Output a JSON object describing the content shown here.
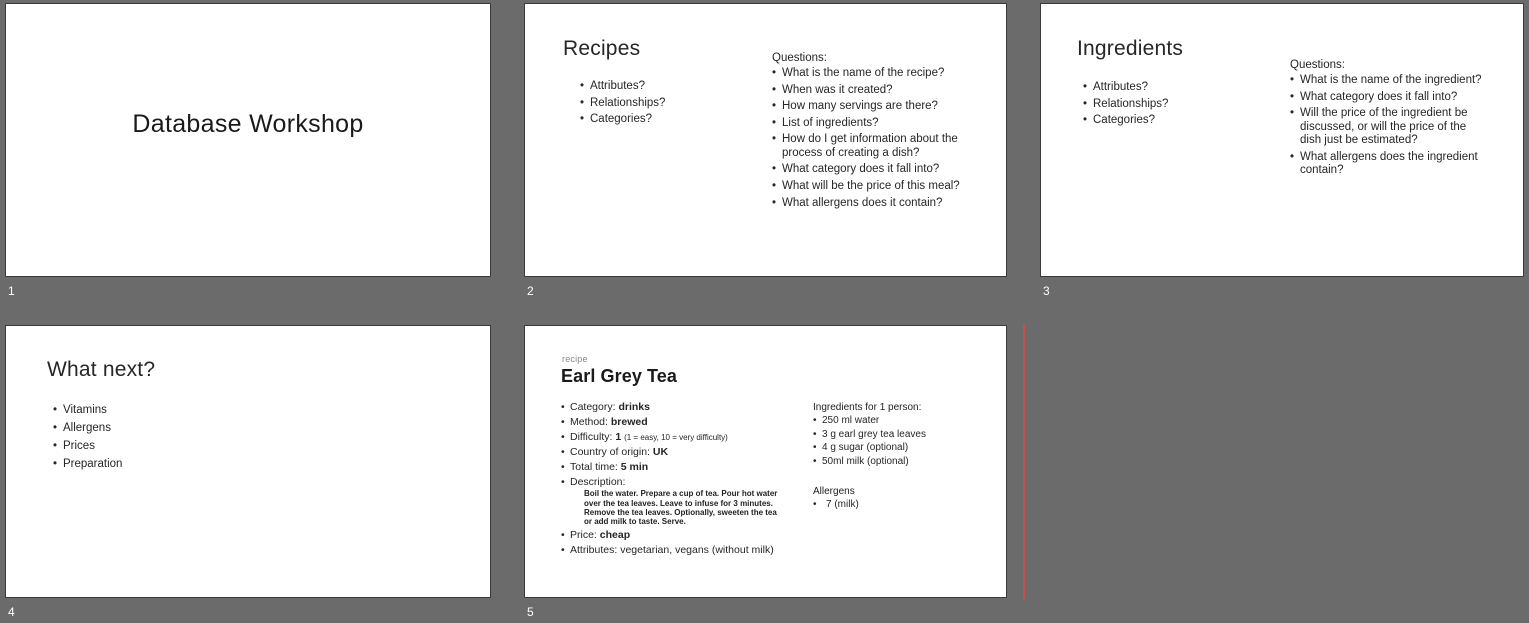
{
  "app": {
    "view": "slide-sorter",
    "background_color": "#6b6b6b",
    "slide_border_color": "#3a3a3a",
    "insertion_marker_color": "#c0504d"
  },
  "slides": [
    {
      "number": "1",
      "title": "Database Workshop"
    },
    {
      "number": "2",
      "title": "Recipes",
      "left_bullets": [
        "Attributes?",
        "Relationships?",
        "Categories?"
      ],
      "right_heading": "Questions:",
      "right_bullets": [
        "What is the name of the recipe?",
        "When was it created?",
        "How many servings are there?",
        "List of ingredients?",
        "How do I get information about the process of creating a dish?",
        "What category does it fall into?",
        "What will be the price of this meal?",
        "What allergens does it contain?"
      ]
    },
    {
      "number": "3",
      "title": "Ingredients",
      "left_bullets": [
        "Attributes?",
        "Relationships?",
        "Categories?"
      ],
      "right_heading": "Questions:",
      "right_bullets": [
        "What is the name of the ingredient?",
        "What category does it fall into?",
        "Will the price of the ingredient be discussed, or will the price of the dish just be estimated?",
        "What allergens does the ingredient contain?"
      ]
    },
    {
      "number": "4",
      "title": "What next?",
      "bullets": [
        "Vitamins",
        "Allergens",
        "Prices",
        "Preparation"
      ]
    },
    {
      "number": "5",
      "kicker": "recipe",
      "title": "Earl Grey Tea",
      "facts": [
        {
          "label": "Category:",
          "value": "drinks"
        },
        {
          "label": "Method:",
          "value": "brewed"
        },
        {
          "label": "Difficulty:",
          "value": "1",
          "note": "(1 = easy, 10 = very difficulty)"
        },
        {
          "label": "Country of origin:",
          "value": "UK"
        },
        {
          "label": "Total time:",
          "value": "5 min"
        }
      ],
      "description_label": "Description:",
      "description": "Boil the water. Prepare a cup of tea. Pour hot water over the tea leaves. Leave to infuse for 3 minutes. Remove the tea leaves. Optionally, sweeten the tea or add milk to taste. Serve.",
      "price_label": "Price:",
      "price_value": "cheap",
      "attributes_label": "Attributes:",
      "attributes_value": "vegetarian, vegans (without milk)",
      "ingredients_heading": "Ingredients for 1 person:",
      "ingredients": [
        "250 ml water",
        "3 g earl grey tea leaves",
        "4 g sugar (optional)",
        "50ml milk (optional)"
      ],
      "allergens_heading": "Allergens",
      "allergens": [
        "7 (milk)"
      ]
    }
  ]
}
